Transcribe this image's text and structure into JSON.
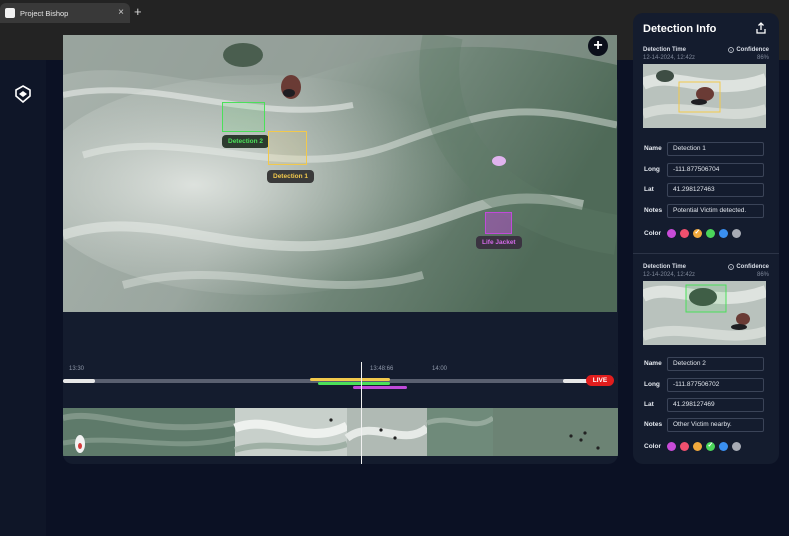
{
  "browser": {
    "tab_title": "Project Bishop",
    "tab_close": "×",
    "new_tab": "+"
  },
  "player": {
    "add_button": "+",
    "detections": [
      {
        "label": "Detection 2",
        "color": "#4be05a"
      },
      {
        "label": "Detection 1",
        "color": "#f2c94c"
      },
      {
        "label": "Life Jacket",
        "color": "#c04ad9"
      }
    ],
    "controls": [
      "skip-back-icon",
      "play-icon",
      "skip-forward-icon"
    ]
  },
  "timeline": {
    "labels": [
      "13:30",
      "13:48:66",
      "14:00"
    ],
    "live_label": "LIVE",
    "segments": [
      {
        "color": "#f2c94c"
      },
      {
        "color": "#4be05a"
      },
      {
        "color": "#c04ad9"
      }
    ]
  },
  "info": {
    "title": "Detection Info",
    "share_icon": "share-icon",
    "color_label": "Color",
    "color_options": [
      "#c84bd8",
      "#f0506e",
      "#f0a83c",
      "#4bd55a",
      "#3a8ff0",
      "#a7abb4"
    ],
    "detections": [
      {
        "time_label": "Detection Time",
        "time_value": "12-14-2024, 12:42z",
        "confidence_label": "Confidence",
        "confidence_value": "86%",
        "name_label": "Name",
        "name_value": "Detection 1",
        "long_label": "Long",
        "long_value": "-111.877506704",
        "lat_label": "Lat",
        "lat_value": "41.298127463",
        "notes_label": "Notes",
        "notes_value": "Potential Victim detected.",
        "selected_color_index": 2
      },
      {
        "time_label": "Detection Time",
        "time_value": "12-14-2024, 12:42z",
        "confidence_label": "Confidence",
        "confidence_value": "86%",
        "name_label": "Name",
        "name_value": "Detection 2",
        "long_label": "Long",
        "long_value": "-111.877506702",
        "lat_label": "Lat",
        "lat_value": "41.298127469",
        "notes_label": "Notes",
        "notes_value": "Other Victim nearby.",
        "selected_color_index": 3
      }
    ]
  }
}
